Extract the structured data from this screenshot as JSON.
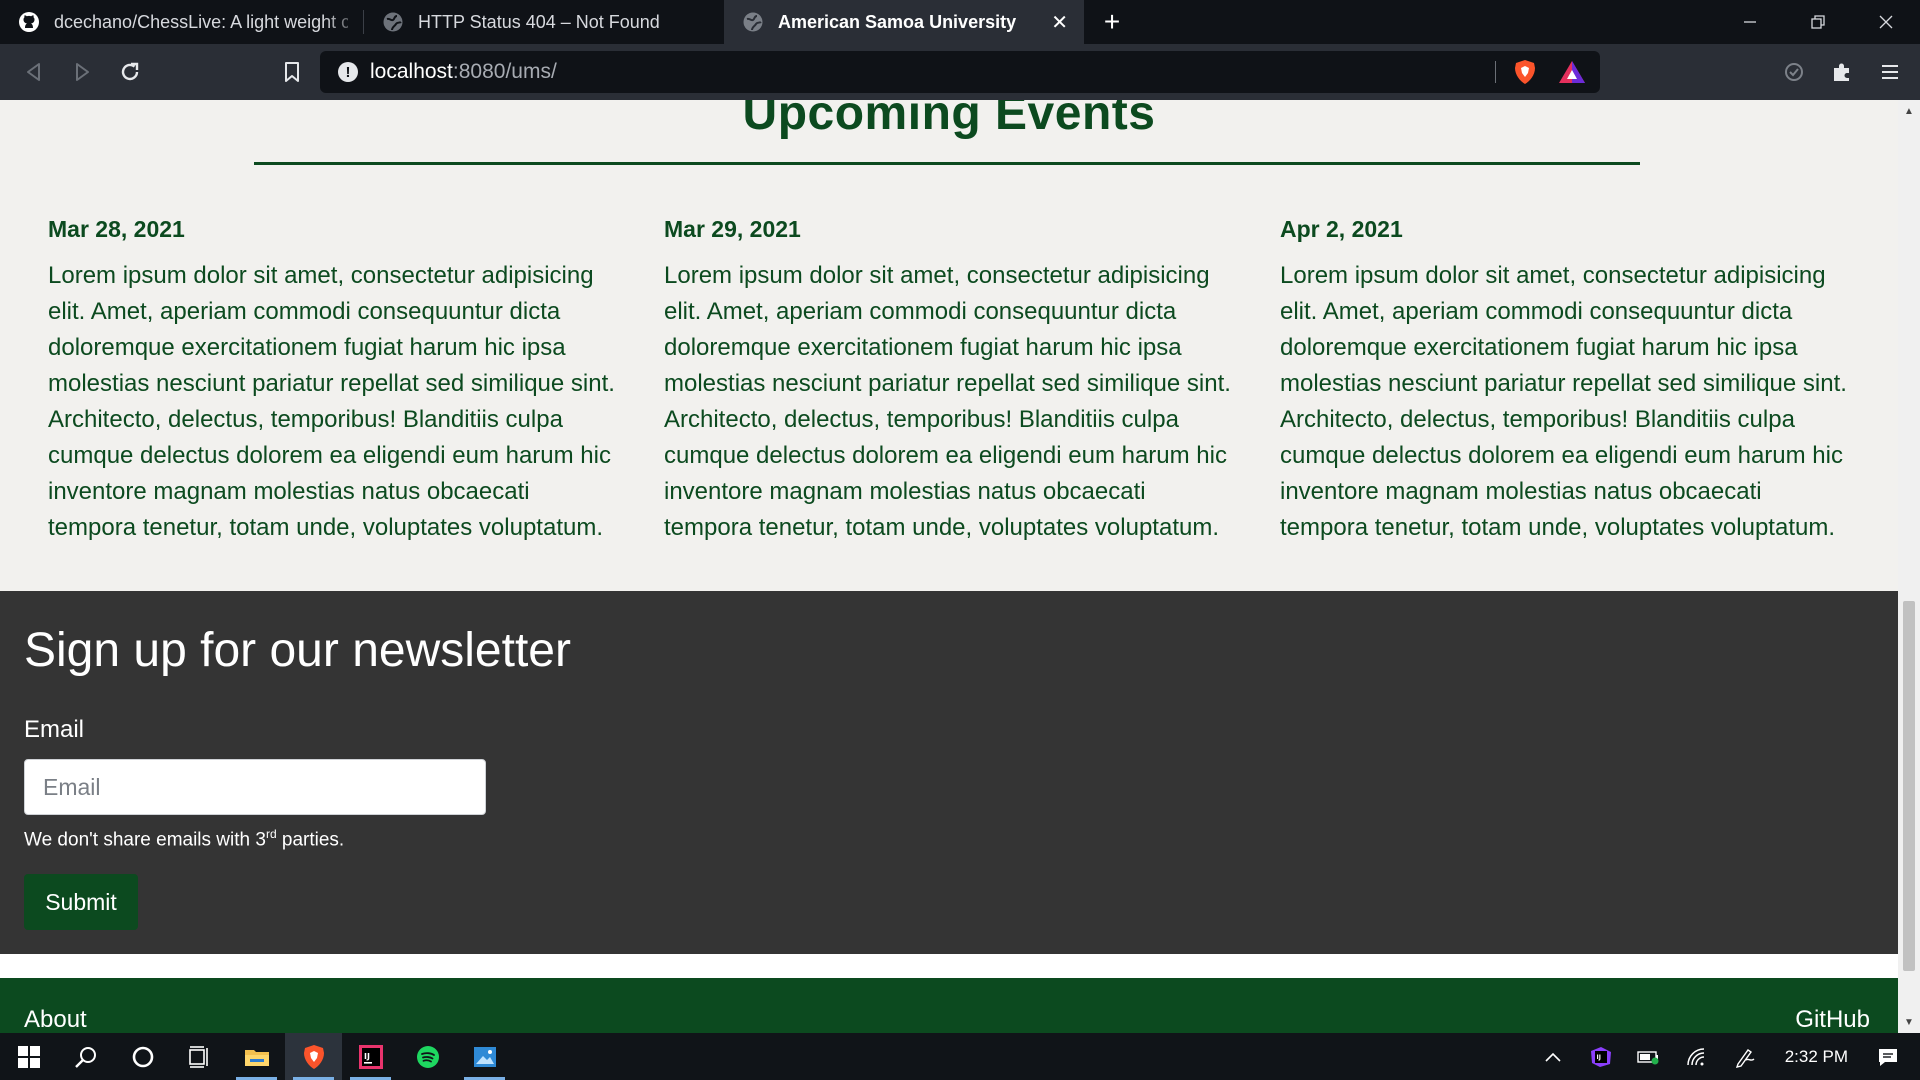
{
  "browser": {
    "tabs": [
      {
        "title": "dcechano/ChessLive: A light weight chess app",
        "icon": "github-icon",
        "active": false
      },
      {
        "title": "HTTP Status 404 – Not Found",
        "icon": "globe-icon",
        "active": false
      },
      {
        "title": "American Samoa University",
        "icon": "globe-icon",
        "active": true
      }
    ],
    "new_tab_label": "+",
    "close_tab_label": "✕",
    "window_controls": {
      "minimize": "—",
      "restore": "❐",
      "close": "✕"
    },
    "url": {
      "host": "localhost",
      "path": ":8080/ums/"
    }
  },
  "page": {
    "events_title": "Upcoming Events",
    "events": [
      {
        "date": "Mar 28, 2021",
        "description": "Lorem ipsum dolor sit amet, consectetur adipisicing elit. Amet, aperiam commodi consequuntur dicta doloremque exercitationem fugiat harum hic ipsa molestias nesciunt pariatur repellat sed similique sint. Architecto, delectus, temporibus! Blanditiis culpa cumque delectus dolorem ea eligendi eum harum hic inventore magnam molestias natus obcaecati tempora tenetur, totam unde, voluptates voluptatum."
      },
      {
        "date": "Mar 29, 2021",
        "description": "Lorem ipsum dolor sit amet, consectetur adipisicing elit. Amet, aperiam commodi consequuntur dicta doloremque exercitationem fugiat harum hic ipsa molestias nesciunt pariatur repellat sed similique sint. Architecto, delectus, temporibus! Blanditiis culpa cumque delectus dolorem ea eligendi eum harum hic inventore magnam molestias natus obcaecati tempora tenetur, totam unde, voluptates voluptatum."
      },
      {
        "date": "Apr 2, 2021",
        "description": "Lorem ipsum dolor sit amet, consectetur adipisicing elit. Amet, aperiam commodi consequuntur dicta doloremque exercitationem fugiat harum hic ipsa molestias nesciunt pariatur repellat sed similique sint. Architecto, delectus, temporibus! Blanditiis culpa cumque delectus dolorem ea eligendi eum harum hic inventore magnam molestias natus obcaecati tempora tenetur, totam unde, voluptates voluptatum."
      }
    ],
    "newsletter": {
      "title": "Sign up for our newsletter",
      "email_label": "Email",
      "email_placeholder": "Email",
      "email_value": "",
      "help_prefix": "We don't share emails with 3",
      "help_sup": "rd",
      "help_suffix": " parties.",
      "submit_label": "Submit"
    },
    "footer": {
      "about": "About",
      "github": "GitHub"
    }
  },
  "taskbar": {
    "apps": [
      "windows-start-icon",
      "search-icon",
      "cortana-icon",
      "task-view-icon",
      "file-explorer-icon",
      "brave-browser-icon",
      "intellij-icon",
      "spotify-icon",
      "photos-icon"
    ],
    "active_app": "brave-browser-icon",
    "clock": "2:32 PM"
  },
  "colors": {
    "brand_green": "#0c4a1f",
    "page_bg": "#f2f1ee",
    "newsletter_bg": "#343434",
    "chrome_dark": "#0f1217",
    "toolbar_bg": "#2a2e36"
  }
}
